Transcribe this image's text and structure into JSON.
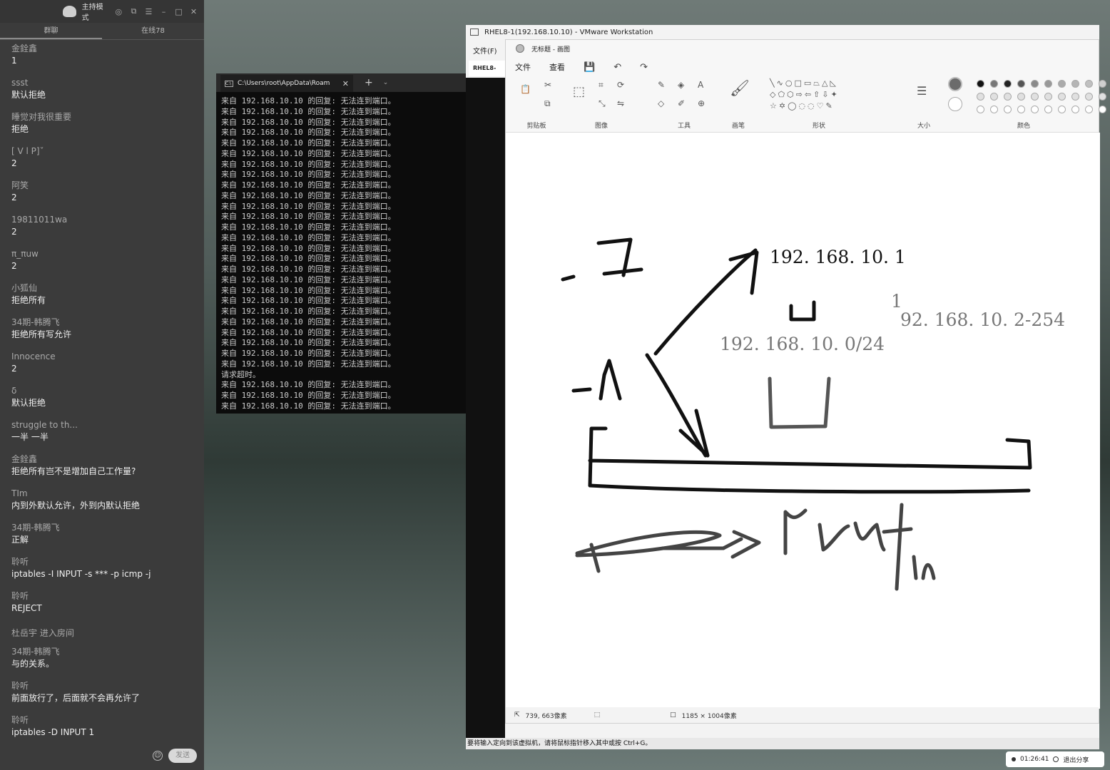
{
  "chat": {
    "host_mode_label": "主持模式",
    "tabs": [
      "群聊",
      "在线78"
    ],
    "messages": [
      {
        "author": "金銓鑫",
        "text": "1"
      },
      {
        "author": "ssst",
        "text": "默认拒绝"
      },
      {
        "author": "睡觉对我很重要",
        "text": "拒绝"
      },
      {
        "author": "[     V      l      P]ˇ",
        "text": "2"
      },
      {
        "author": "阿笑",
        "text": "2"
      },
      {
        "author": "19811011wa",
        "text": "2"
      },
      {
        "author": "π_πuw",
        "text": "2"
      },
      {
        "author": "小狐仙",
        "text": "拒绝所有"
      },
      {
        "author": "34期-韩腾飞",
        "text": "拒绝所有写允许"
      },
      {
        "author": "Innocence",
        "text": "2"
      },
      {
        "author": "δ",
        "text": "默认拒绝"
      },
      {
        "author": "struggle to th...",
        "text": "一半 一半"
      },
      {
        "author": "金銓鑫",
        "text": "拒绝所有岂不是增加自己工作量?"
      },
      {
        "author": "TIm",
        "text": "内到外默认允许，外到内默认拒绝"
      },
      {
        "author": "34期-韩腾飞",
        "text": "正解"
      },
      {
        "author": "聆听",
        "text": "iptables -I INPUT -s *** -p icmp -j"
      },
      {
        "author": "聆听",
        "text": "REJECT"
      },
      {
        "author": "杜岳宇 进入房间",
        "text": ""
      },
      {
        "author": "34期-韩腾飞",
        "text": "与的关系。"
      },
      {
        "author": "聆听",
        "text": "前面放行了，后面就不会再允许了"
      },
      {
        "author": "聆听",
        "text": "iptables -D INPUT 1"
      }
    ],
    "send_label": "发送"
  },
  "terminal": {
    "tab_title": "C:\\Users\\root\\AppData\\Roam",
    "reply_line": "来自 192.168.10.10 的回复: 无法连到端口。",
    "timeout_line": "请求超时。",
    "lines_before_timeout": 26,
    "lines_after_timeout": 3
  },
  "vmware": {
    "title": "RHEL8-1(192.168.10.10) - VMware Workstation",
    "menu_file": "文件(F)",
    "vm_tab": "RHEL8-",
    "status": "要将输入定向到该虚拟机，请将鼠标指针移入其中或按 Ctrl+G。"
  },
  "paint": {
    "title": "无标题 - 画图",
    "menu": [
      "文件",
      "查看"
    ],
    "groups": [
      "剪贴板",
      "图像",
      "工具",
      "画笔",
      "形状",
      "大小",
      "颜色"
    ],
    "canvas_texts": [
      "192. 168. 10. 1",
      "1",
      "92. 168. 10. 2-254",
      "192. 168. 10. 0/24"
    ],
    "cursor_pos": "739, 663像素",
    "canvas_size": "1185 × 1004像素"
  },
  "share": {
    "time": "01:26:41",
    "stop_label": "退出分享"
  }
}
